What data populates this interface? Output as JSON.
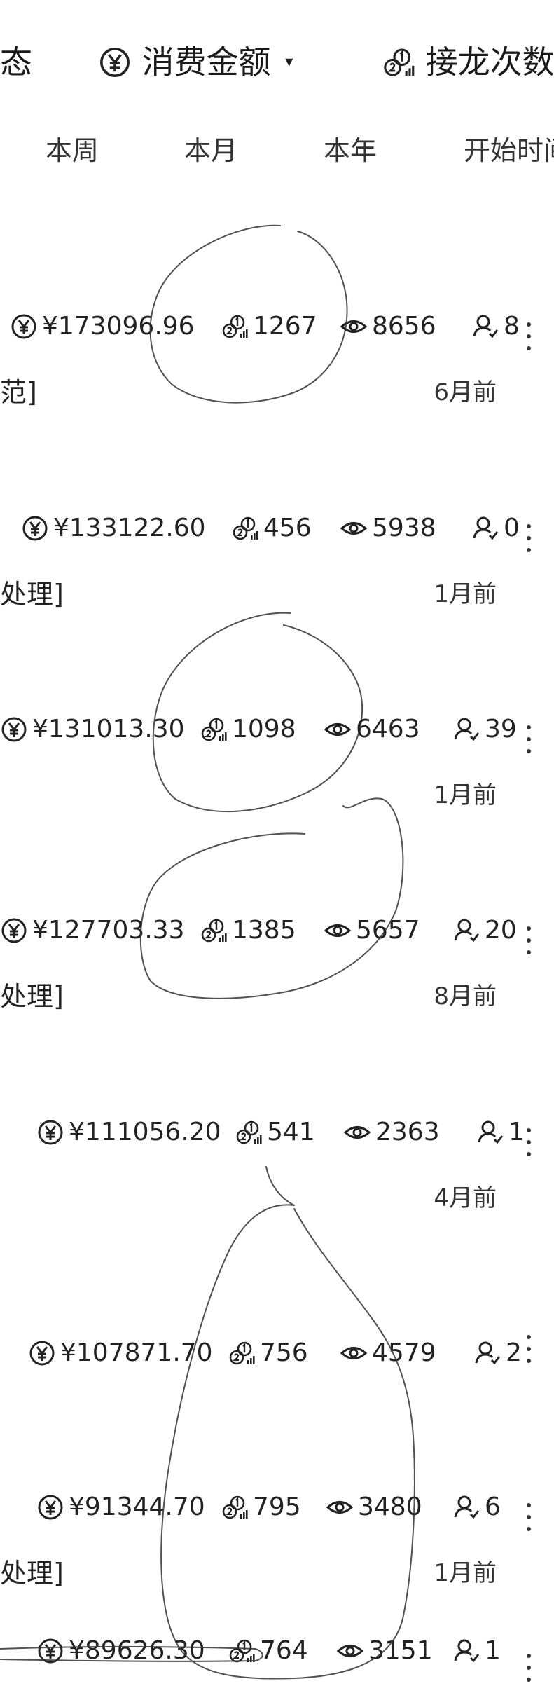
{
  "header": {
    "sort_options": [
      {
        "label": "态",
        "icon": ""
      },
      {
        "label": "消费金额",
        "icon": "yuan-circle-icon",
        "has_caret": true
      },
      {
        "label": "接龙次数",
        "icon": "ranking-coins-icon"
      }
    ],
    "ranges": [
      "本周",
      "本月",
      "本年",
      "开始时间"
    ]
  },
  "rows": [
    {
      "amount": "¥173096.96",
      "count": "1267",
      "views": "8656",
      "users": "8",
      "left_text": "范]",
      "time": "6月前"
    },
    {
      "amount": "¥133122.60",
      "count": "456",
      "views": "5938",
      "users": "0",
      "left_text": "处理]",
      "time": "1月前"
    },
    {
      "amount": "¥131013.30",
      "count": "1098",
      "views": "6463",
      "users": "39",
      "left_text": "",
      "time": "1月前"
    },
    {
      "amount": "¥127703.33",
      "count": "1385",
      "views": "5657",
      "users": "20",
      "left_text": "处理]",
      "time": "8月前"
    },
    {
      "amount": "¥111056.20",
      "count": "541",
      "views": "2363",
      "users": "1",
      "left_text": "",
      "time": "4月前"
    },
    {
      "amount": "¥107871.70",
      "count": "756",
      "views": "4579",
      "users": "2",
      "left_text": "",
      "time": ""
    },
    {
      "amount": "¥91344.70",
      "count": "795",
      "views": "3480",
      "users": "6",
      "left_text": "处理]",
      "time": "1月前"
    },
    {
      "amount": "¥89626.30",
      "count": "764",
      "views": "3151",
      "users": "1",
      "left_text": "",
      "time": ""
    }
  ]
}
